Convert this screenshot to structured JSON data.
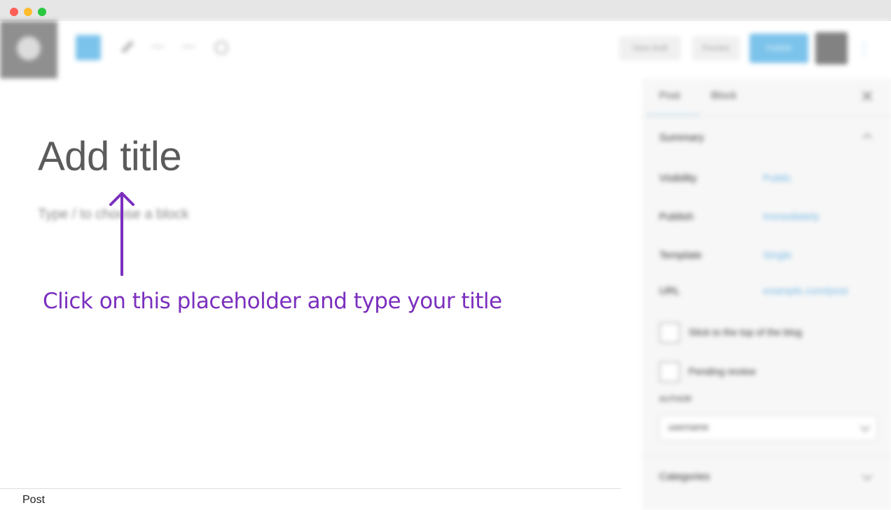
{
  "window": {
    "controls": [
      "close",
      "minimize",
      "zoom"
    ]
  },
  "toolbar": {
    "logo_icon": "wordpress-logo",
    "icons": [
      "add-block-icon",
      "pen-icon",
      "undo-icon",
      "redo-icon",
      "tools-icon"
    ],
    "save_draft_label": "Save draft",
    "preview_label": "Preview",
    "publish_label": "Publish",
    "settings_icon": "gear-icon",
    "more_icon": "more-vertical-icon"
  },
  "editor": {
    "title_placeholder": "Add title",
    "block_placeholder": "Type / to choose a block"
  },
  "annotation": {
    "text": "Click on this placeholder and type your title",
    "color": "#7B2FBE"
  },
  "sidebar": {
    "tabs": [
      "Post",
      "Block"
    ],
    "summary_heading": "Summary",
    "rows": [
      {
        "label": "Visibility",
        "value": "Public"
      },
      {
        "label": "Publish",
        "value": "Immediately"
      },
      {
        "label": "Template",
        "value": "Single"
      },
      {
        "label": "URL",
        "value": "example.com/post"
      }
    ],
    "checkbox_1": "Stick to the top of the blog",
    "checkbox_2": "Pending review",
    "author_label": "AUTHOR",
    "author_value": "username",
    "categories_heading": "Categories"
  },
  "footer": {
    "breadcrumb": "Post"
  },
  "colors": {
    "accent": "#7CC3EB",
    "annotation": "#7B2FBE"
  }
}
